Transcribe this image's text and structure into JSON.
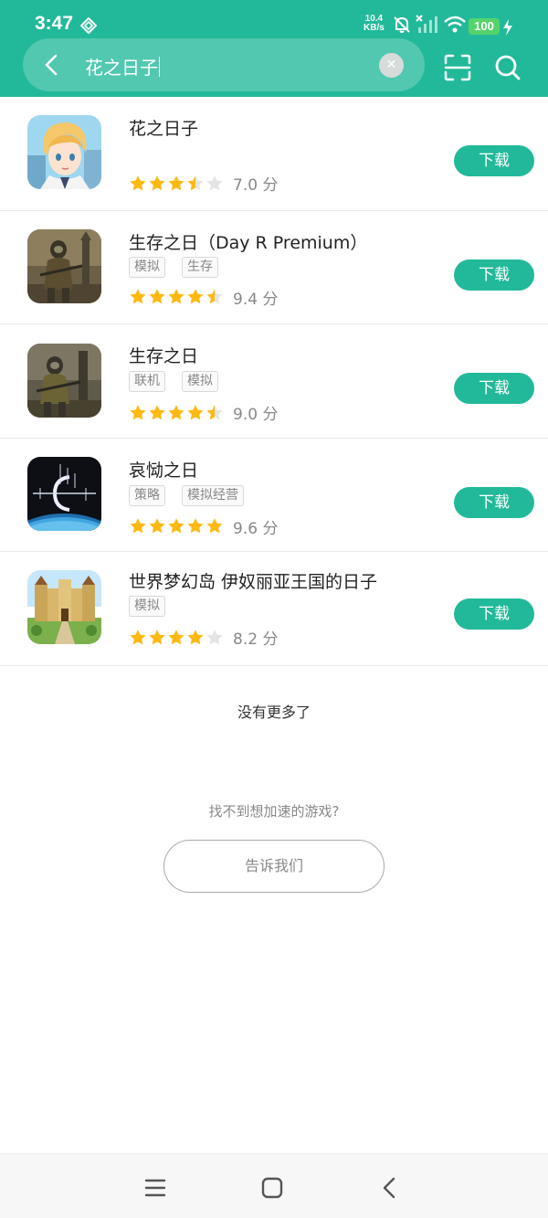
{
  "status_bar": {
    "time": "3:47",
    "net_speed_value": "10.4",
    "net_speed_unit": "KB/s",
    "battery": "100",
    "icons": [
      "diamond-app-icon",
      "bell-muted-icon",
      "signal-off-icon",
      "wifi-icon",
      "charging-icon"
    ]
  },
  "search": {
    "query": "花之日子",
    "icons": [
      "back-arrow-icon",
      "clear-icon",
      "scan-icon",
      "search-icon"
    ]
  },
  "colors": {
    "accent": "#22b99a",
    "star": "#fdb913",
    "star_empty": "#e4e4e4",
    "battery": "#55d36b"
  },
  "results": [
    {
      "name": "花之日子",
      "tags": [],
      "rating": 3.5,
      "score": "7.0 分",
      "button": "下载",
      "icon": "anime-boy-icon"
    },
    {
      "name": "生存之日（Day R Premium）",
      "tags": [
        "模拟",
        "生存"
      ],
      "rating": 4.5,
      "score": "9.4 分",
      "button": "下载",
      "icon": "survivor-icon"
    },
    {
      "name": "生存之日",
      "tags": [
        "联机",
        "模拟"
      ],
      "rating": 4.5,
      "score": "9.0 分",
      "button": "下载",
      "icon": "survivor-icon"
    },
    {
      "name": "哀恸之日",
      "tags": [
        "策略",
        "模拟经营"
      ],
      "rating": 5,
      "score": "9.6 分",
      "button": "下载",
      "icon": "dark-planet-icon"
    },
    {
      "name": "世界梦幻岛 伊奴丽亚王国的日子",
      "tags": [
        "模拟"
      ],
      "rating": 4,
      "score": "8.2 分",
      "button": "下载",
      "icon": "castle-icon"
    }
  ],
  "footer": {
    "no_more": "没有更多了",
    "cant_find": "找不到想加速的游戏?",
    "tell_us": "告诉我们"
  },
  "nav_icons": [
    "menu-icon",
    "home-icon",
    "back-icon"
  ]
}
